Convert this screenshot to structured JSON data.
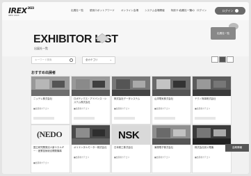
{
  "logo": {
    "main": "IREX",
    "sup": "2023",
    "sub": "IREX 2023"
  },
  "nav": {
    "items": [
      "出展社一覧",
      "優良ロボットアワード",
      "オンライン会場",
      "システム会場開催",
      "特設サイト",
      "FAQ"
    ],
    "right": [
      "出展社一覧",
      "ログイン"
    ],
    "pill_label": "ログイン"
  },
  "hero": {
    "title": "EXHIBITOR LIST",
    "subtitle": "出展社一覧",
    "badge": "出展社一覧"
  },
  "search": {
    "placeholder": "キーワード検索",
    "select_value": "全カテゴリ"
  },
  "section_title": "おすすめ出展者",
  "side_label": "会期情報",
  "cards": [
    {
      "name": "ニッテレ株式会社",
      "meta": "■出展者カテゴリ"
    },
    {
      "name": "ロボティクス・アドバンス・システム株式会社",
      "meta": "■出展者カテゴリ"
    },
    {
      "name": "株式会社データシステム",
      "meta": "■出展者カテゴリ"
    },
    {
      "name": "山洋電気株式会社",
      "meta": "■出展者カテゴリ"
    },
    {
      "name": "テクノ商事株式会社",
      "meta": "■出展者カテゴリ"
    },
    {
      "name": "国立研究開発法人新エネルギー・産業技術総合開発機構",
      "meta": "■出展者カテゴリ",
      "logo": "NEDO"
    },
    {
      "name": "オリエンタルモーター株式会社",
      "meta": "■出展者カテゴリ"
    },
    {
      "name": "日本精工株式会社",
      "meta": "■出展者カテゴリ",
      "logo": "NSK"
    },
    {
      "name": "東陽電子株式会社",
      "meta": "■出展者カテゴリ"
    },
    {
      "name": "株式会社安川電機",
      "meta": "■出展者カテゴリ"
    }
  ]
}
